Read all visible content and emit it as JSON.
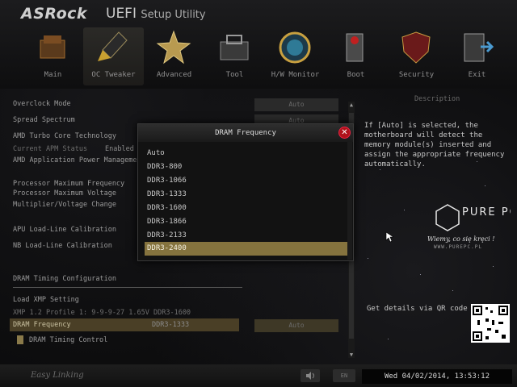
{
  "header": {
    "brand": "ASRock",
    "title_main": "UEFI",
    "title_sub": "Setup Utility"
  },
  "nav": [
    {
      "label": "Main",
      "icon": "main-icon"
    },
    {
      "label": "OC Tweaker",
      "icon": "rocket-icon",
      "active": true
    },
    {
      "label": "Advanced",
      "icon": "star-icon"
    },
    {
      "label": "Tool",
      "icon": "toolbox-icon"
    },
    {
      "label": "H/W Monitor",
      "icon": "monitor-icon"
    },
    {
      "label": "Boot",
      "icon": "boot-icon"
    },
    {
      "label": "Security",
      "icon": "shield-icon"
    },
    {
      "label": "Exit",
      "icon": "exit-icon"
    }
  ],
  "settings": {
    "overclock_mode": "Overclock Mode",
    "overclock_mode_value": "Auto",
    "spread_spectrum": "Spread Spectrum",
    "spread_spectrum_value": "Auto",
    "turbo_core": "AMD Turbo Core Technology",
    "apm_status": "Current APM Status",
    "apm_status_value": "Enabled",
    "app_power": "AMD Application Power Management",
    "proc_max_freq": "Processor Maximum Frequency",
    "proc_max_volt": "Processor Maximum Voltage",
    "mult_volt": "Multiplier/Voltage Change",
    "apu_llc": "APU Load-Line Calibration",
    "nb_llc": "NB Load-Line Calibration",
    "dram_timing_config": "DRAM Timing Configuration",
    "load_xmp": "Load XMP Setting",
    "xmp_profile": "XMP 1.2 Profile 1: 9-9-9-27 1.65V DDR3-1600",
    "dram_frequency": "DRAM Frequency",
    "dram_frequency_value": "DDR3-1333",
    "dram_frequency_box": "Auto",
    "dram_timing_control": "DRAM Timing Control"
  },
  "description": {
    "title": "Description",
    "text": "If [Auto] is selected, the motherboard will detect the memory module(s) inserted and assign the appropriate frequency automatically.",
    "qr_label": "Get details via QR code"
  },
  "watermark": {
    "logo": "PURE PC",
    "tagline": "Wiemy, co się kręci !",
    "url": "WWW.PUREPC.PL"
  },
  "dialog": {
    "title": "DRAM Frequency",
    "options": [
      "Auto",
      "DDR3-800",
      "DDR3-1066",
      "DDR3-1333",
      "DDR3-1600",
      "DDR3-1866",
      "DDR3-2133",
      "DDR3-2400"
    ],
    "selected_index": 7
  },
  "footer": {
    "brand": "Easy Linking",
    "lang": "EN",
    "datetime": "Wed 04/02/2014, 13:53:12"
  },
  "colors": {
    "accent": "#85733e",
    "close": "#b0121a"
  }
}
